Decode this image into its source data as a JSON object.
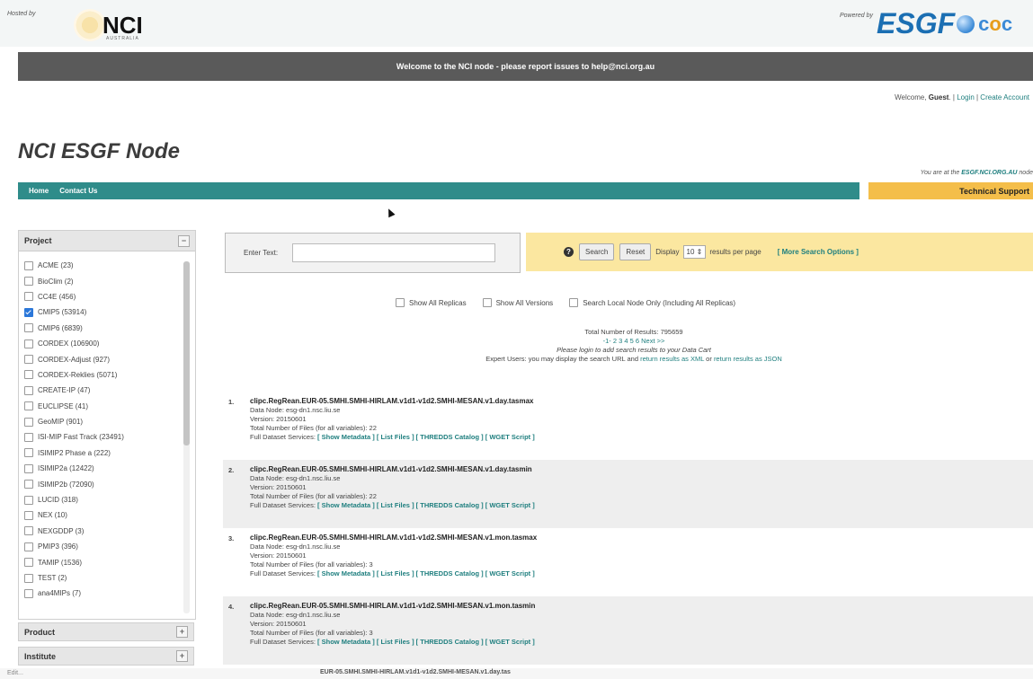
{
  "header": {
    "hosted_by": "Hosted by",
    "nci_logo": "NCI",
    "nci_sub": "AUSTRALIA",
    "powered_by": "Powered by",
    "esgf_logo": "ESGF"
  },
  "welcome_banner": "Welcome to the NCI node - please report issues to help@nci.org.au",
  "userline": {
    "prefix": "Welcome, ",
    "user": "Guest",
    "sep1": ". | ",
    "login": "Login",
    "sep2": " | ",
    "create": "Create Account"
  },
  "title": "NCI ESGF Node",
  "at_node": {
    "prefix": "You are at the ",
    "node": "ESGF.NCI.ORG.AU",
    "suffix": " node"
  },
  "nav": {
    "home": "Home",
    "contact": "Contact Us",
    "tech": "Technical Support"
  },
  "facets": {
    "project_label": "Project",
    "items": [
      {
        "label": "ACME (23)",
        "checked": false
      },
      {
        "label": "BioClim (2)",
        "checked": false
      },
      {
        "label": "CC4E (456)",
        "checked": false
      },
      {
        "label": "CMIP5 (53914)",
        "checked": true
      },
      {
        "label": "CMIP6 (6839)",
        "checked": false
      },
      {
        "label": "CORDEX (106900)",
        "checked": false
      },
      {
        "label": "CORDEX-Adjust (927)",
        "checked": false
      },
      {
        "label": "CORDEX-Reklies (5071)",
        "checked": false
      },
      {
        "label": "CREATE-IP (47)",
        "checked": false
      },
      {
        "label": "EUCLIPSE (41)",
        "checked": false
      },
      {
        "label": "GeoMIP (901)",
        "checked": false
      },
      {
        "label": "ISI-MIP Fast Track (23491)",
        "checked": false
      },
      {
        "label": "ISIMIP2 Phase a (222)",
        "checked": false
      },
      {
        "label": "ISIMIP2a (12422)",
        "checked": false
      },
      {
        "label": "ISIMIP2b (72090)",
        "checked": false
      },
      {
        "label": "LUCID (318)",
        "checked": false
      },
      {
        "label": "NEX (10)",
        "checked": false
      },
      {
        "label": "NEXGDDP (3)",
        "checked": false
      },
      {
        "label": "PMIP3 (396)",
        "checked": false
      },
      {
        "label": "TAMIP (1536)",
        "checked": false
      },
      {
        "label": "TEST (2)",
        "checked": false
      },
      {
        "label": "ana4MIPs (7)",
        "checked": false
      }
    ],
    "product_label": "Product",
    "institute_label": "Institute"
  },
  "search": {
    "label": "Enter Text:",
    "value": "",
    "search_btn": "Search",
    "reset_btn": "Reset",
    "display": "Display",
    "per_page": "10",
    "per_page_suffix": "results per page",
    "more": "[ More Search Options ]"
  },
  "checks": [
    "Show All Replicas",
    "Show All Versions",
    "Search Local Node Only (Including All Replicas)"
  ],
  "summary": {
    "total": "Total Number of Results: 795659",
    "pages": "-1- 2 3 4 5 6 Next >>",
    "login_note": "Please login to add search results to your Data Cart",
    "expert_prefix": "Expert Users: you may display the search URL and ",
    "xml": "return results as XML",
    "or": " or ",
    "json": "return results as JSON"
  },
  "results": [
    {
      "num": "1.",
      "title": "clipc.RegRean.EUR-05.SMHI.SMHI-HIRLAM.v1d1-v1d2.SMHI-MESAN.v1.day.tasmax",
      "node": "Data Node: esg-dn1.nsc.liu.se",
      "version": "Version: 20150601",
      "files": "Total Number of Files (for all variables): 22"
    },
    {
      "num": "2.",
      "title": "clipc.RegRean.EUR-05.SMHI.SMHI-HIRLAM.v1d1-v1d2.SMHI-MESAN.v1.day.tasmin",
      "node": "Data Node: esg-dn1.nsc.liu.se",
      "version": "Version: 20150601",
      "files": "Total Number of Files (for all variables): 22"
    },
    {
      "num": "3.",
      "title": "clipc.RegRean.EUR-05.SMHI.SMHI-HIRLAM.v1d1-v1d2.SMHI-MESAN.v1.mon.tasmax",
      "node": "Data Node: esg-dn1.nsc.liu.se",
      "version": "Version: 20150601",
      "files": "Total Number of Files (for all variables): 3"
    },
    {
      "num": "4.",
      "title": "clipc.RegRean.EUR-05.SMHI.SMHI-HIRLAM.v1d1-v1d2.SMHI-MESAN.v1.mon.tasmin",
      "node": "Data Node: esg-dn1.nsc.liu.se",
      "version": "Version: 20150601",
      "files": "Total Number of Files (for all variables): 3"
    }
  ],
  "services": {
    "prefix": "Full Dataset Services: ",
    "metadata": "[ Show Metadata ]",
    "list_files": "[ List Files ]",
    "thredds": "[ THREDDS Catalog ]",
    "wget": "[ WGET Script ]"
  },
  "status_bar": {
    "left": "Edit...",
    "ghost": "EUR-05.SMHI.SMHI-HIRLAM.v1d1-v1d2.SMHI-MESAN.v1.day.tas"
  }
}
